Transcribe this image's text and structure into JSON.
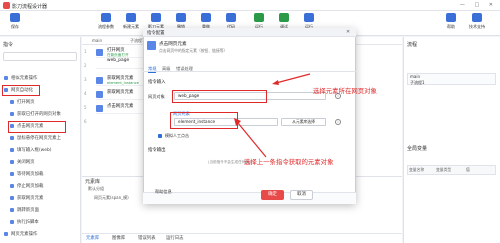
{
  "window": {
    "title": "影刀流程设计器",
    "controls": "— □ ✕"
  },
  "toolbar": {
    "items": [
      {
        "label": "保存",
        "color": "#3b6fd8"
      },
      {
        "label": "流程参数",
        "color": "#3b6fd8"
      },
      {
        "label": "新建元素",
        "color": "#3b6fd8"
      },
      {
        "label": "影刀元素",
        "color": "#3b6fd8"
      },
      {
        "label": "撤销",
        "color": "#3b6fd8"
      },
      {
        "label": "重做",
        "color": "#3b6fd8"
      },
      {
        "label": "代码",
        "color": "#3b6fd8"
      },
      {
        "label": "运行",
        "color": "#2a9a48"
      },
      {
        "label": "调试",
        "color": "#2a9a48"
      },
      {
        "label": "运行",
        "color": "#3b6fd8"
      },
      {
        "label": "帮助",
        "color": "#3b6fd8"
      },
      {
        "label": "技术支持",
        "color": "#3b6fd8"
      }
    ]
  },
  "left_panel": {
    "header": "指令",
    "search_placeholder": "",
    "tree": [
      "相似元素操作",
      "网页自动化",
      "打开网页",
      "获取已打开的网页对象",
      "点击网页元素",
      "鼠标悬停在网页元素上",
      "填写输入框(web)",
      "关闭网页",
      "等待网页加载",
      "停止网页加载",
      "获取网页元素",
      "跳转新页面",
      "执行JS脚本",
      "网页元素操作"
    ]
  },
  "editor": {
    "tabs": [
      "main",
      "子流程1"
    ],
    "line_numbers": [
      "1",
      "2",
      "3",
      "4",
      "5",
      "6"
    ],
    "rows": [
      {
        "title": "打开网页",
        "sub": "在新页面打开"
      },
      {
        "title": "web_page",
        "sub": ""
      },
      {
        "title": "获取网页元素",
        "sub": "element_instance"
      },
      {
        "title": "获取网页元素",
        "sub": ""
      },
      {
        "title": "点击网页元素",
        "sub": ""
      },
      {
        "title": "",
        "sub": ""
      }
    ]
  },
  "right_panel": {
    "header": "流程",
    "flows": [
      "main",
      "子流程1"
    ],
    "global_vars_header": "全局变量",
    "columns": [
      "变量名称",
      "变量类型",
      "值"
    ]
  },
  "bottom_panel": {
    "header": "元素库",
    "tree": [
      "默认分组",
      "网页元素(span_模)"
    ],
    "tabs": [
      "元素库",
      "图像库",
      "错误列表",
      "运行日志"
    ]
  },
  "dialog": {
    "title": "指令配置",
    "close": "✕",
    "command_name": "点击网页元素",
    "command_desc": "点击网页中的指定元素（按钮、链接等）",
    "tabs": [
      "常规",
      "高级",
      "错误处理"
    ],
    "input_section": "指令输入",
    "web_obj_label": "网页对象",
    "web_obj_value": "web_page",
    "elem_label": "网页元素",
    "elem_value": "element_instance",
    "elem_btn": "从元素库选择",
    "simulate_label": "模拟人工点击",
    "hint": "(当前指令不会生成任何输出)",
    "output_section": "指令输出",
    "help": "帮助信息",
    "ok": "确定",
    "cancel": "取消"
  },
  "annotations": {
    "a1": "选择元素所在网页对象",
    "a2": "选择上一条指令获取的元素对象",
    "color": "#e02a2a"
  }
}
